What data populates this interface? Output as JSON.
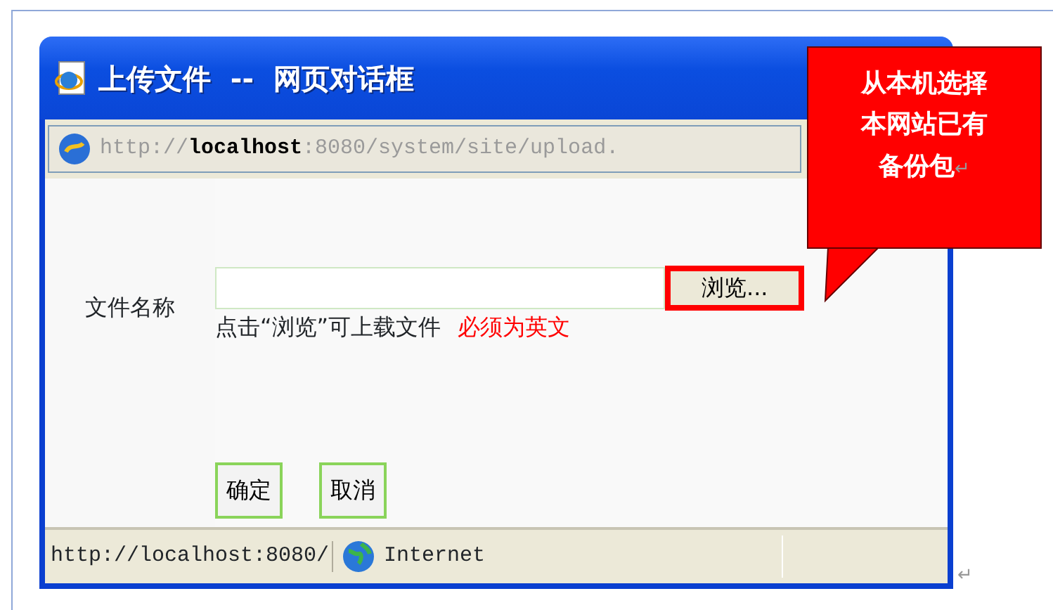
{
  "window": {
    "title": "上传文件  --  网页对话框"
  },
  "address_bar": {
    "url": "http://**localhost**:8080/system/site/upload."
  },
  "form": {
    "label": "文件名称",
    "browse_button": "浏览...",
    "hint": "点击“浏览”可上载文件",
    "warning": "必须为英文"
  },
  "buttons": [
    "确定",
    "取消"
  ],
  "status_bar": {
    "url": "http://localhost:8080/",
    "zone": "Internet"
  },
  "callout": {
    "lines": [
      "从本机选择",
      "本网站已有",
      "备份包"
    ]
  },
  "paragraph_marks": [
    "↵",
    "↵"
  ]
}
